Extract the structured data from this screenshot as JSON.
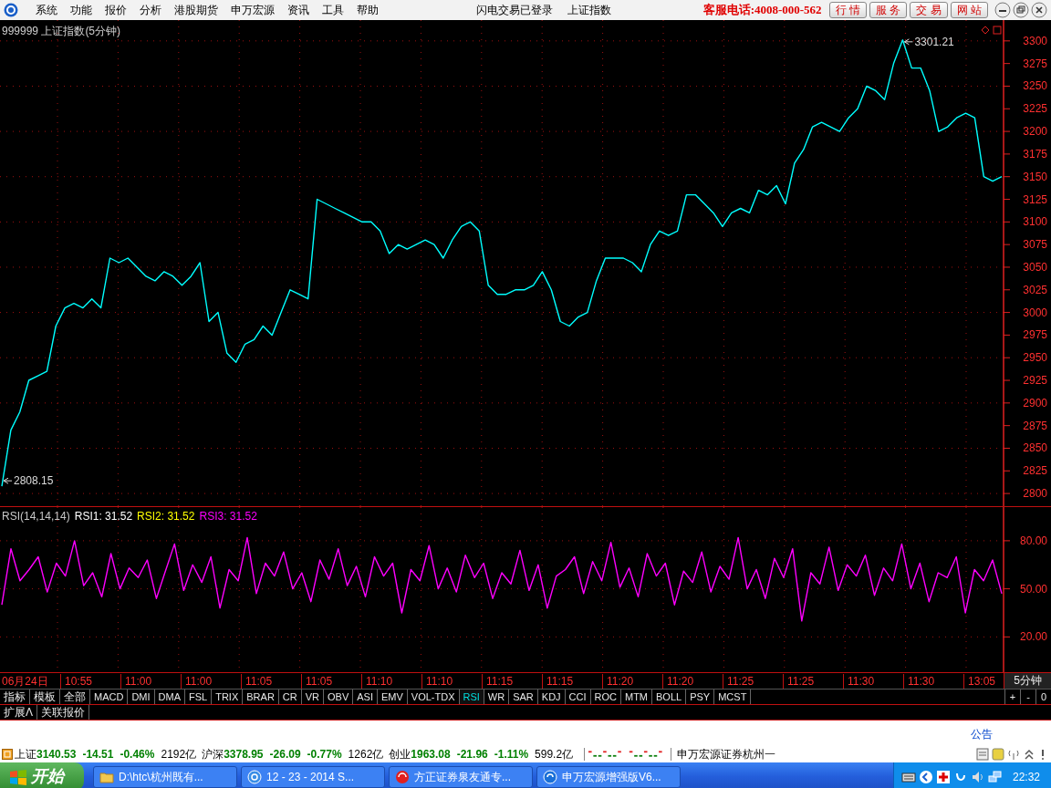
{
  "menu": [
    "系统",
    "功能",
    "报价",
    "分析",
    "港股期货",
    "申万宏源",
    "资讯",
    "工具",
    "帮助"
  ],
  "login_status": "闪电交易已登录",
  "index_name": "上证指数",
  "hotline": "客服电话:4008-000-562",
  "top_buttons": [
    "行 情",
    "服 务",
    "交 易",
    "网 站"
  ],
  "price_panel": {
    "title": "999999 上证指数(5分钟)",
    "chart_data": {
      "type": "line",
      "ylim": [
        2786,
        3323
      ],
      "yticks": [
        2800,
        2825,
        2850,
        2875,
        2900,
        2925,
        2950,
        2975,
        3000,
        3025,
        3050,
        3075,
        3100,
        3125,
        3150,
        3175,
        3200,
        3225,
        3250,
        3275,
        3300
      ],
      "grid": true,
      "series": [
        {
          "color": "#00ffff",
          "values": [
            2808,
            2870,
            2890,
            2925,
            2930,
            2935,
            2985,
            3005,
            3010,
            3005,
            3015,
            3005,
            3060,
            3055,
            3060,
            3050,
            3040,
            3035,
            3045,
            3040,
            3030,
            3040,
            3055,
            2990,
            3000,
            2955,
            2945,
            2965,
            2970,
            2985,
            2975,
            3000,
            3025,
            3020,
            3015,
            3125,
            3120,
            3115,
            3110,
            3105,
            3100,
            3100,
            3090,
            3065,
            3075,
            3070,
            3075,
            3080,
            3075,
            3060,
            3080,
            3095,
            3100,
            3090,
            3030,
            3020,
            3020,
            3025,
            3025,
            3030,
            3045,
            3025,
            2990,
            2985,
            2995,
            3000,
            3035,
            3060,
            3060,
            3060,
            3055,
            3045,
            3075,
            3090,
            3085,
            3090,
            3130,
            3130,
            3120,
            3110,
            3095,
            3110,
            3115,
            3110,
            3135,
            3130,
            3140,
            3120,
            3165,
            3180,
            3205,
            3210,
            3205,
            3200,
            3215,
            3225,
            3250,
            3245,
            3235,
            3275,
            3301,
            3270,
            3270,
            3245,
            3200,
            3205,
            3215,
            3220,
            3215,
            3150,
            3145,
            3150
          ]
        }
      ],
      "annotations": [
        "3301.21",
        "2808.15"
      ]
    }
  },
  "rsi_panel": {
    "title": "RSI(14,14,14)",
    "legend": [
      {
        "label": "RSI1: 31.52",
        "color": "#ffffff"
      },
      {
        "label": "RSI2: 31.52",
        "color": "#ffff00"
      },
      {
        "label": "RSI3: 31.52",
        "color": "#ff00ff"
      }
    ],
    "chart_data": {
      "type": "line",
      "ylim": [
        -2,
        101
      ],
      "yticks": [
        {
          "value": 20,
          "label": "20.00"
        },
        {
          "value": 50,
          "label": "50.00"
        },
        {
          "value": 80,
          "label": "80.00"
        }
      ],
      "grid": true,
      "series": [
        {
          "color": "#ff00ff",
          "values": [
            40,
            75,
            55,
            62,
            70,
            48,
            66,
            58,
            80,
            52,
            60,
            45,
            72,
            50,
            63,
            57,
            68,
            44,
            61,
            78,
            49,
            65,
            54,
            70,
            38,
            62,
            55,
            82,
            47,
            66,
            58,
            73,
            50,
            60,
            42,
            68,
            56,
            75,
            52,
            64,
            45,
            70,
            58,
            66,
            35,
            62,
            55,
            77,
            50,
            63,
            48,
            71,
            57,
            66,
            44,
            60,
            53,
            74,
            49,
            65,
            38,
            58,
            62,
            70,
            47,
            67,
            55,
            79,
            51,
            63,
            45,
            72,
            58,
            66,
            40,
            61,
            54,
            73,
            48,
            64,
            56,
            82,
            50,
            62,
            44,
            69,
            57,
            75,
            30,
            60,
            53,
            76,
            49,
            65,
            58,
            71,
            46,
            63,
            55,
            78,
            50,
            66,
            42,
            60,
            57,
            70,
            35,
            62,
            55,
            68,
            47
          ]
        }
      ]
    }
  },
  "time_axis": [
    "06月24日",
    "10:55",
    "11:00",
    "11:00",
    "11:05",
    "11:05",
    "11:10",
    "11:10",
    "11:15",
    "11:15",
    "11:20",
    "11:20",
    "11:25",
    "11:25",
    "11:30",
    "11:30",
    "13:05"
  ],
  "period": "5分钟",
  "indicator_tabs": [
    {
      "label": "指标",
      "selected": false
    },
    {
      "label": "模板",
      "selected": false
    },
    {
      "label": "全部",
      "selected": false
    },
    {
      "label": "MACD",
      "selected": false
    },
    {
      "label": "DMI",
      "selected": false
    },
    {
      "label": "DMA",
      "selected": false
    },
    {
      "label": "FSL",
      "selected": false
    },
    {
      "label": "TRIX",
      "selected": false
    },
    {
      "label": "BRAR",
      "selected": false
    },
    {
      "label": "CR",
      "selected": false
    },
    {
      "label": "VR",
      "selected": false
    },
    {
      "label": "OBV",
      "selected": false
    },
    {
      "label": "ASI",
      "selected": false
    },
    {
      "label": "EMV",
      "selected": false
    },
    {
      "label": "VOL-TDX",
      "selected": false
    },
    {
      "label": "RSI",
      "selected": true
    },
    {
      "label": "WR",
      "selected": false
    },
    {
      "label": "SAR",
      "selected": false
    },
    {
      "label": "KDJ",
      "selected": false
    },
    {
      "label": "CCI",
      "selected": false
    },
    {
      "label": "ROC",
      "selected": false
    },
    {
      "label": "MTM",
      "selected": false
    },
    {
      "label": "BOLL",
      "selected": false
    },
    {
      "label": "PSY",
      "selected": false
    },
    {
      "label": "MCST",
      "selected": false
    }
  ],
  "zoom_buttons": [
    "+",
    "-",
    "0"
  ],
  "extra_tabs": [
    "扩展Λ",
    "关联报价"
  ],
  "notice_link": "公告",
  "status_bar": {
    "indices": [
      {
        "name": "上证",
        "value": "3140.53",
        "change": "-14.51",
        "pct": "-0.46%",
        "amount": "2192亿"
      },
      {
        "name": "沪深",
        "value": "3378.95",
        "change": "-26.09",
        "pct": "-0.77%",
        "amount": "1262亿"
      },
      {
        "name": "创业",
        "value": "1963.08",
        "change": "-21.96",
        "pct": "-1.11%",
        "amount": "599.2亿"
      }
    ],
    "broker": "申万宏源证券杭州一"
  },
  "taskbar": {
    "start": "开始",
    "tasks": [
      {
        "kind": "folder",
        "label": "D:\\htc\\杭州既有..."
      },
      {
        "kind": "browser",
        "label": "12 - 23 - 2014 S..."
      },
      {
        "kind": "swirl",
        "label": "方正证券泉友通专..."
      },
      {
        "kind": "app",
        "label": "申万宏源增强版V6..."
      }
    ],
    "clock": "22:32"
  }
}
